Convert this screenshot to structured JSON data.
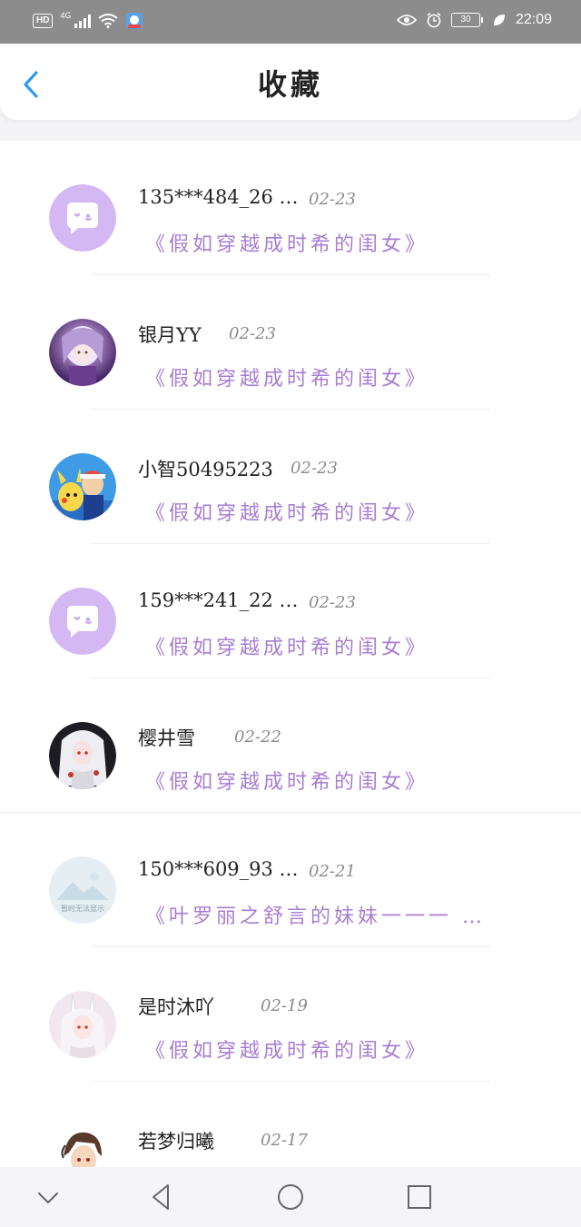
{
  "status_bar": {
    "hd": "HD",
    "network": "4G",
    "battery": "30",
    "time": "22:09"
  },
  "header": {
    "title": "收藏"
  },
  "list": [
    {
      "name": "135***484_26 …",
      "date": "02-23",
      "book": "《假如穿越成时希的闺女》",
      "avatar": "default-chat-icon"
    },
    {
      "name": "银月YY",
      "date": "02-23",
      "book": "《假如穿越成时希的闺女》",
      "avatar": "anime-girl-purple"
    },
    {
      "name": "小智50495223",
      "date": "02-23",
      "book": "《假如穿越成时希的闺女》",
      "avatar": "pikachu-ash"
    },
    {
      "name": "159***241_22 …",
      "date": "02-23",
      "book": "《假如穿越成时希的闺女》",
      "avatar": "default-chat-icon"
    },
    {
      "name": "樱井雪",
      "date": "02-22",
      "book": "《假如穿越成时希的闺女》",
      "avatar": "anime-girl-white-hair"
    },
    {
      "name": "150***609_93 …",
      "date": "02-21",
      "book": "《叶罗丽之舒言的妹妹一一一 …",
      "avatar": "no-image-placeholder",
      "avatar_text": "暂时无法显示"
    },
    {
      "name": "是时沐吖",
      "date": "02-19",
      "book": "《假如穿越成时希的闺女》",
      "avatar": "anime-girl-bunny-ears"
    },
    {
      "name": "若梦归曦",
      "date": "02-17",
      "book": "",
      "avatar": "anime-boy-brown-hair"
    }
  ],
  "colors": {
    "accent": "#2f9bf0",
    "book_title": "#a77ed1",
    "default_avatar": "#d4b8f3"
  }
}
